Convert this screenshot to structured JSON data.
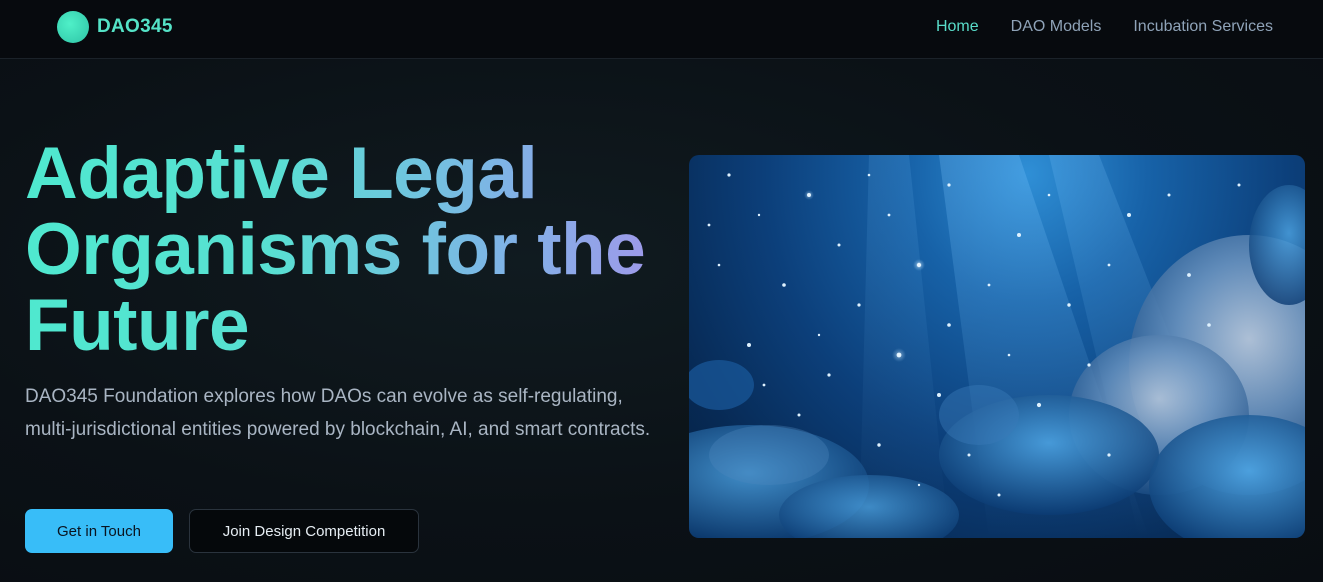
{
  "brand": {
    "name": "DAO345",
    "accent": "#55e3c7"
  },
  "nav": {
    "items": [
      {
        "label": "Home",
        "active": true
      },
      {
        "label": "DAO Models",
        "active": false
      },
      {
        "label": "Incubation Services",
        "active": false
      }
    ]
  },
  "hero": {
    "title": "Adaptive Legal Organisms for the Future",
    "description": "DAO345 Foundation explores how DAOs can evolve as self-regulating, multi-jurisdictional entities powered by blockchain, AI, and smart contracts.",
    "primary_button": "Get in Touch",
    "secondary_button": "Join Design Competition",
    "image_subject": "underwater coral reef with light rays and glowing particles"
  },
  "colors": {
    "primary_button_bg": "#38bdf8",
    "nav_active": "#59dcc9",
    "title_gradient_start": "#4fe8cf",
    "title_gradient_end": "#a197ea"
  }
}
